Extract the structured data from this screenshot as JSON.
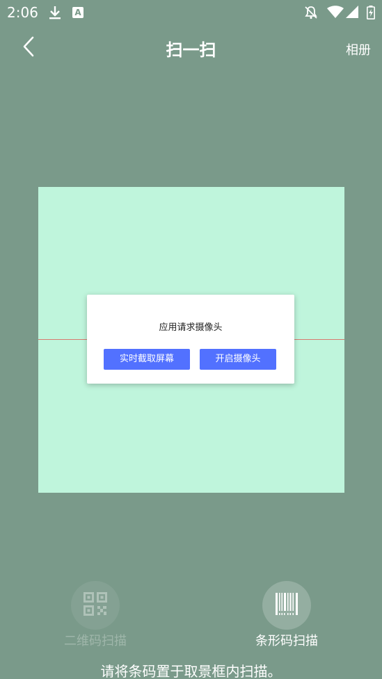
{
  "status_bar": {
    "time": "2:06",
    "icons": [
      "download-icon",
      "a-app-icon",
      "bell-off-icon",
      "wifi-icon",
      "signal-icon",
      "battery-charging-icon"
    ]
  },
  "header": {
    "title": "扫一扫",
    "album_label": "相册",
    "back_icon": "chevron-left-icon"
  },
  "dialog": {
    "message": "应用请求摄像头",
    "screen_capture_label": "实时截取屏幕",
    "open_camera_label": "开启摄像头",
    "button_color": "#5271ff"
  },
  "modes": {
    "qr": {
      "label": "二维码扫描",
      "icon": "qr-code-icon",
      "active": false
    },
    "barcode": {
      "label": "条形码扫描",
      "icon": "barcode-icon",
      "active": true
    }
  },
  "hint": "请将条码置于取景框内扫描。",
  "colors": {
    "background": "#7a9a8a",
    "scan_frame": "#bff5dc",
    "scan_line": "#d77a6f"
  }
}
